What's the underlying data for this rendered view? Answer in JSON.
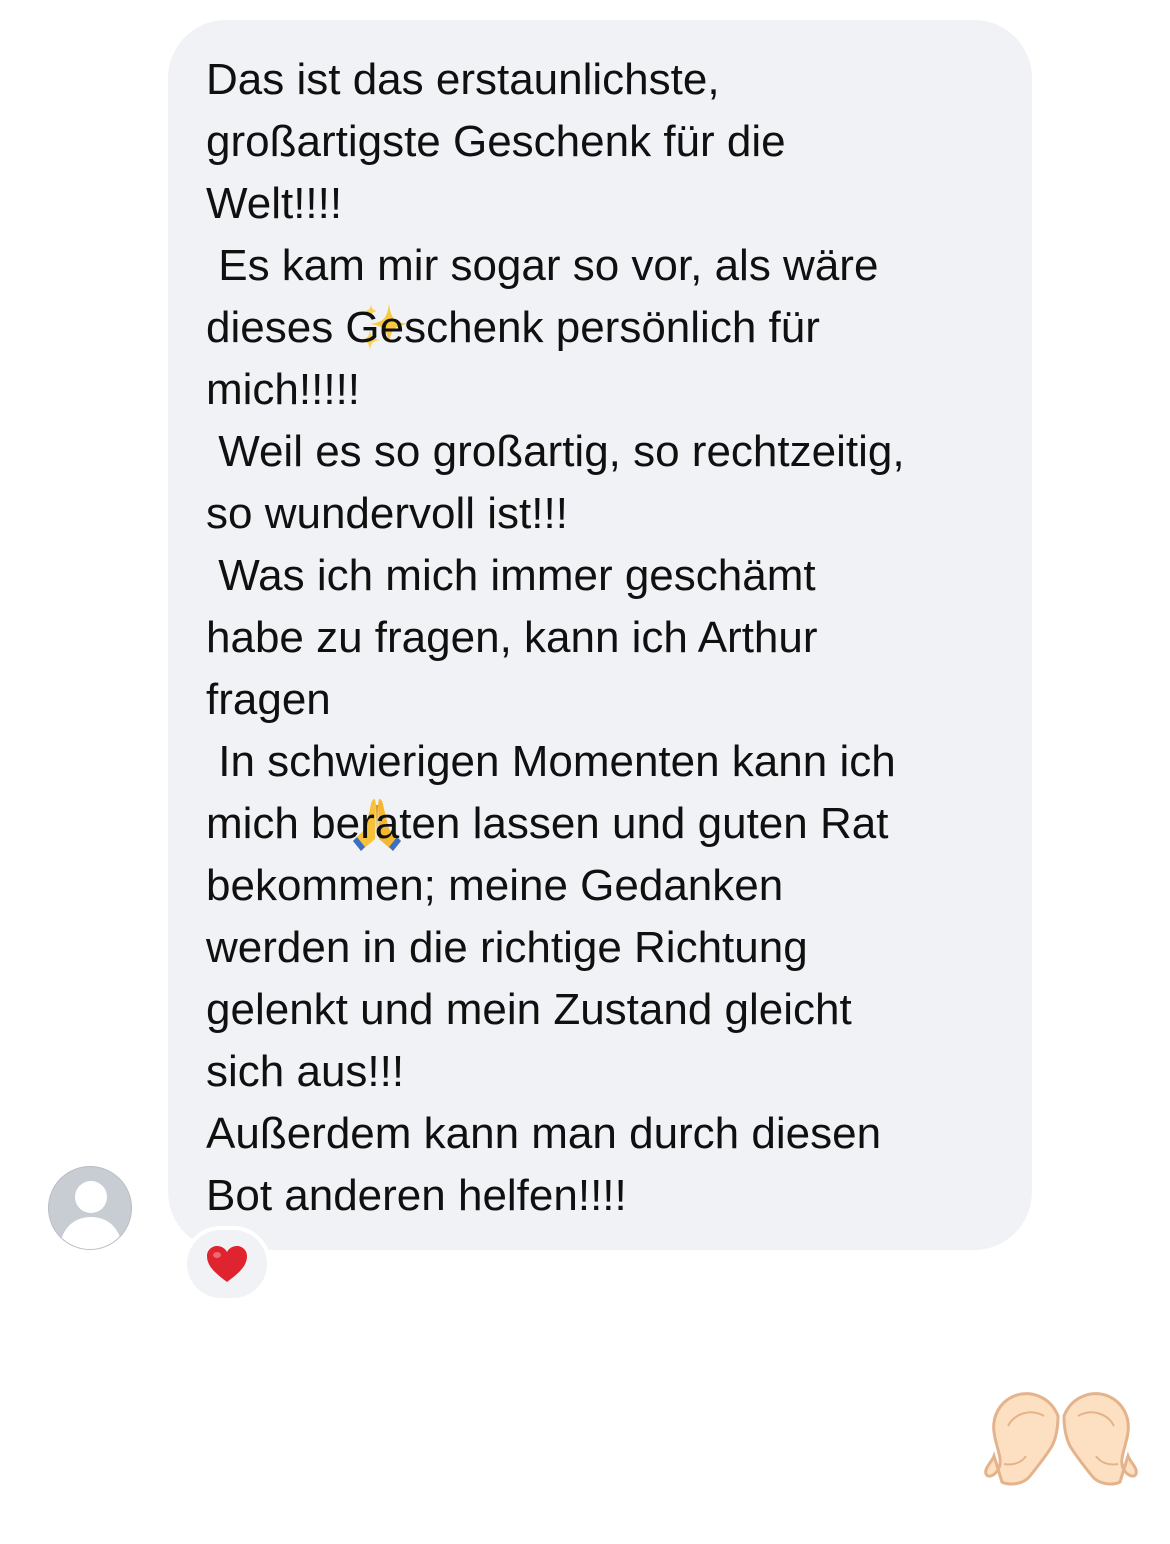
{
  "message": {
    "lines": [
      "Das ist das erstaunlichste,",
      "großartigste Geschenk für die",
      "Welt!!!! ",
      " Es kam mir sogar so vor, als wäre",
      "dieses Geschenk persönlich für",
      "mich!!!!!",
      " Weil es so großartig, so rechtzeitig,",
      "so wundervoll ist!!!",
      " Was ich mich immer geschämt",
      "habe zu fragen, kann ich Arthur",
      "fragen ",
      " In schwierigen Momenten kann ich",
      "mich beraten lassen und guten Rat",
      "bekommen; meine Gedanken",
      "werden in die richtige Richtung",
      "gelenkt und mein Zustand gleicht",
      "sich aus!!!",
      "Außerdem kann man durch diesen",
      "Bot anderen helfen!!!!"
    ],
    "inline_emojis": [
      "sparkles-icon",
      "folded-hands-icon"
    ]
  },
  "reaction": {
    "icon": "red-heart-icon",
    "color": "#e0242f"
  },
  "sent_sticker": {
    "icon": "heart-hands-icon"
  },
  "colors": {
    "bubble": "#f1f2f5",
    "text": "#101010",
    "avatar": "#c8ccd3",
    "background": "#ffffff"
  }
}
